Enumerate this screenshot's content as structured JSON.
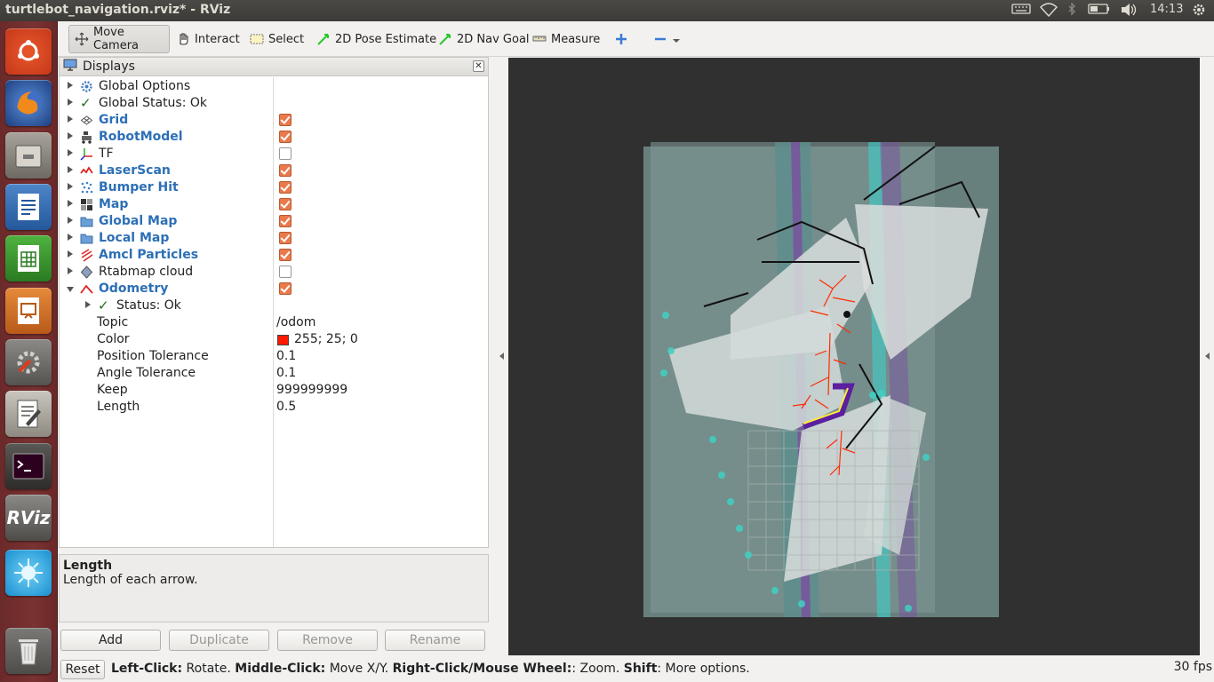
{
  "window": {
    "title": "turtlebot_navigation.rviz* - RViz"
  },
  "tray": {
    "time": "14:13"
  },
  "launcher": [
    {
      "name": "ubuntu-logo-icon"
    },
    {
      "name": "firefox-icon"
    },
    {
      "name": "files-icon"
    },
    {
      "name": "writer-icon"
    },
    {
      "name": "calc-icon"
    },
    {
      "name": "impress-icon"
    },
    {
      "name": "system-settings-icon"
    },
    {
      "name": "text-editor-icon"
    },
    {
      "name": "terminal-icon"
    },
    {
      "name": "rviz-icon",
      "label": "RViz"
    },
    {
      "name": "blue-app-icon"
    },
    {
      "name": "trash-icon"
    }
  ],
  "toolbar": {
    "move_camera": "Move Camera",
    "interact": "Interact",
    "select": "Select",
    "pose_estimate": "2D Pose Estimate",
    "nav_goal": "2D Nav Goal",
    "measure": "Measure"
  },
  "displays": {
    "title": "Displays",
    "items": [
      {
        "label": "Global Options"
      },
      {
        "label": "Global Status: Ok"
      },
      {
        "label": "Grid",
        "checked": true
      },
      {
        "label": "RobotModel",
        "checked": true
      },
      {
        "label": "TF",
        "checked": false
      },
      {
        "label": "LaserScan",
        "checked": true
      },
      {
        "label": "Bumper Hit",
        "checked": true
      },
      {
        "label": "Map",
        "checked": true
      },
      {
        "label": "Global Map",
        "checked": true
      },
      {
        "label": "Local Map",
        "checked": true
      },
      {
        "label": "Amcl Particles",
        "checked": true
      },
      {
        "label": "Rtabmap cloud",
        "checked": false
      },
      {
        "label": "Odometry",
        "checked": true
      }
    ],
    "odometry": {
      "status": "Status: Ok",
      "props": [
        {
          "name": "Topic",
          "value": "/odom"
        },
        {
          "name": "Color",
          "value": "255; 25; 0",
          "swatch": "#ff1900"
        },
        {
          "name": "Position Tolerance",
          "value": "0.1"
        },
        {
          "name": "Angle Tolerance",
          "value": "0.1"
        },
        {
          "name": "Keep",
          "value": "999999999"
        },
        {
          "name": "Length",
          "value": "0.5"
        }
      ]
    }
  },
  "description": {
    "title": "Length",
    "text": "Length of each arrow."
  },
  "buttons": {
    "add": "Add",
    "duplicate": "Duplicate",
    "remove": "Remove",
    "rename": "Rename"
  },
  "status": {
    "reset": "Reset",
    "left_click_key": "Left-Click:",
    "left_click_val": " Rotate. ",
    "middle_click_key": "Middle-Click:",
    "middle_click_val": " Move X/Y. ",
    "right_click_key": "Right-Click/Mouse Wheel:",
    "right_click_val": ": Zoom. ",
    "shift_key": "Shift",
    "shift_val": ": More options.",
    "fps": "30 fps"
  },
  "colors": {
    "orange_check": "#e97a4b",
    "link_blue": "#2d6fb6",
    "viewport_bg": "#303030"
  }
}
